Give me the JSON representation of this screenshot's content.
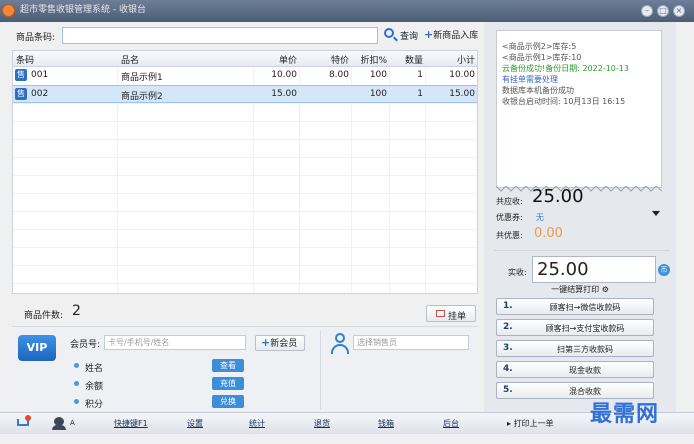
{
  "window": {
    "title": "超市零售收银管理系统 - 收银台",
    "controls": [
      "–",
      "□",
      "×"
    ]
  },
  "search": {
    "label": "商品条码:",
    "value": "",
    "search_label": "查询",
    "add_label": "新商品入库"
  },
  "table": {
    "columns": [
      "条码",
      "品名",
      "单价",
      "特价",
      "折扣%",
      "数量",
      "小计"
    ],
    "rows": [
      {
        "tag": "售",
        "code": "001",
        "name": "商品示例1",
        "price": "10.00",
        "special": "8.00",
        "discount": "100",
        "qty": "1",
        "subtotal": "10.00"
      },
      {
        "tag": "售",
        "code": "002",
        "name": "商品示例2",
        "price": "15.00",
        "special": "",
        "discount": "100",
        "qty": "1",
        "subtotal": "15.00"
      }
    ]
  },
  "summary": {
    "count_label": "商品件数:",
    "count": "2",
    "hold_label": "挂单"
  },
  "member": {
    "vip_label": "VIP",
    "id_label": "会员号:",
    "id_placeholder": "卡号/手机号/姓名",
    "new_member_label": "新会员",
    "info": [
      {
        "label": "姓名",
        "action": "查看"
      },
      {
        "label": "余额",
        "action": "充值"
      },
      {
        "label": "积分",
        "action": "兑换"
      }
    ],
    "sales_placeholder": "选择销售员"
  },
  "receipt": {
    "lines": [
      {
        "text": "<商品示例2>库存:5",
        "tone": "normal"
      },
      {
        "text": "<商品示例1>库存:10",
        "tone": "normal"
      },
      {
        "text": "云备份成功!备份日期: 2022-10-13",
        "tone": "green"
      },
      {
        "text": "有挂单需要处理",
        "tone": "blue"
      },
      {
        "text": "数据库本机备份成功",
        "tone": "normal"
      },
      {
        "text": "收银台启动时间: 10月13日 16:15",
        "tone": "normal"
      }
    ]
  },
  "totals": {
    "due_label": "共应收:",
    "due": "25.00",
    "coupon_label": "优惠券:",
    "coupon": "无",
    "discount_label": "共优惠:",
    "discount": "0.00",
    "paid_label": "实收:",
    "paid": "25.00",
    "coin_icon": "币"
  },
  "payment": {
    "print_label": "一键结算打印",
    "buttons": [
      {
        "num": "1.",
        "label": "顾客扫→微信收款码"
      },
      {
        "num": "2.",
        "label": "顾客扫→支付宝收款码"
      },
      {
        "num": "3.",
        "label": "扫第三方收款码"
      },
      {
        "num": "4.",
        "label": "现金收款"
      },
      {
        "num": "5.",
        "label": "混合收款"
      }
    ]
  },
  "bottom_bar": {
    "user": "A",
    "links": [
      "快捷键F1",
      "设置",
      "统计",
      "退货",
      "钱箱",
      "后台"
    ],
    "print_last": "打印上一单"
  },
  "watermark": "最需网",
  "colors": {
    "accent": "#2e7fd4",
    "selected_row": "#d6e6fa",
    "discount": "#f39a4a",
    "success": "#2e9b2e"
  }
}
